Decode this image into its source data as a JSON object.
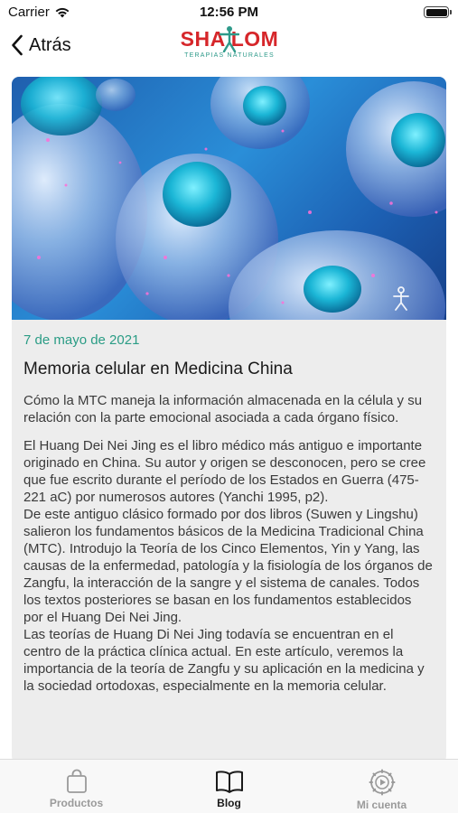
{
  "status_bar": {
    "carrier": "Carrier",
    "time": "12:56 PM",
    "wifi_icon": "wifi-icon",
    "battery_level": 1.0
  },
  "nav": {
    "back_label": "Atrás",
    "logo_text": "SHA LOM",
    "logo_subtitle": "TERAPIAS NATURALES",
    "brand_color": "#d6262a",
    "accent_color": "#2e9a8a"
  },
  "article": {
    "date": "7 de mayo de 2021",
    "title": "Memoria celular en Medicina China",
    "summary": "Cómo la MTC maneja la información almacenada en la célula y su relación con la parte emocional asociada a cada órgano físico.",
    "paragraphs": [
      "El Huang Dei Nei Jing es el libro médico más antiguo e importante originado en China. Su autor y origen se desconocen, pero se cree que fue escrito durante el período de los Estados en Guerra (475-221 aC) por numerosos autores (Yanchi 1995, p2).",
      "De este antiguo clásico formado por dos libros (Suwen y Lingshu) salieron los fundamentos básicos de la Medicina Tradicional China (MTC). Introdujo la Teoría de los Cinco Elementos, Yin y Yang, las causas de la enfermedad, patología y la fisiología de los órganos de Zangfu, la interacción de la sangre y el sistema de canales. Todos los textos posteriores se basan en los fundamentos establecidos por el Huang Dei Nei Jing.",
      "Las teorías de Huang Di Nei Jing todavía se encuentran en el centro de la práctica clínica actual. En este artículo, veremos la importancia de la teoría de Zangfu y su aplicación en la medicina y la sociedad ortodoxas, especialmente en la memoria celular."
    ]
  },
  "tabs": [
    {
      "label": "Productos",
      "icon": "shopping-bag-icon",
      "active": false
    },
    {
      "label": "Blog",
      "icon": "book-icon",
      "active": true
    },
    {
      "label": "Mi cuenta",
      "icon": "account-gear-icon",
      "active": false
    }
  ]
}
